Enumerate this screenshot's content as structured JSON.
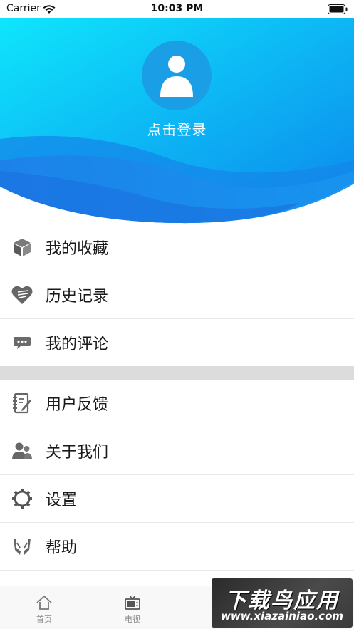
{
  "status_bar": {
    "carrier": "Carrier",
    "time": "10:03 PM"
  },
  "header": {
    "login_text": "点击登录"
  },
  "menu": {
    "group1": [
      {
        "label": "我的收藏",
        "icon": "cube-icon"
      },
      {
        "label": "历史记录",
        "icon": "heart-icon"
      },
      {
        "label": "我的评论",
        "icon": "comment-icon"
      }
    ],
    "group2": [
      {
        "label": "用户反馈",
        "icon": "feedback-icon"
      },
      {
        "label": "关于我们",
        "icon": "users-icon"
      },
      {
        "label": "设置",
        "icon": "gear-icon"
      },
      {
        "label": "帮助",
        "icon": "help-icon"
      }
    ]
  },
  "tab_bar": {
    "tabs": [
      {
        "label": "首页",
        "icon": "home-icon"
      },
      {
        "label": "电视",
        "icon": "tv-icon"
      }
    ]
  },
  "watermark": {
    "main": "下载鸟应用",
    "sub": "www.xiazainiao.com"
  },
  "colors": {
    "header_gradient_start": "#0ee0fb",
    "header_gradient_end": "#0f7be9",
    "avatar_bg": "#1a9ee6",
    "separator": "#dcdcdc",
    "icon_gray": "#666666"
  }
}
